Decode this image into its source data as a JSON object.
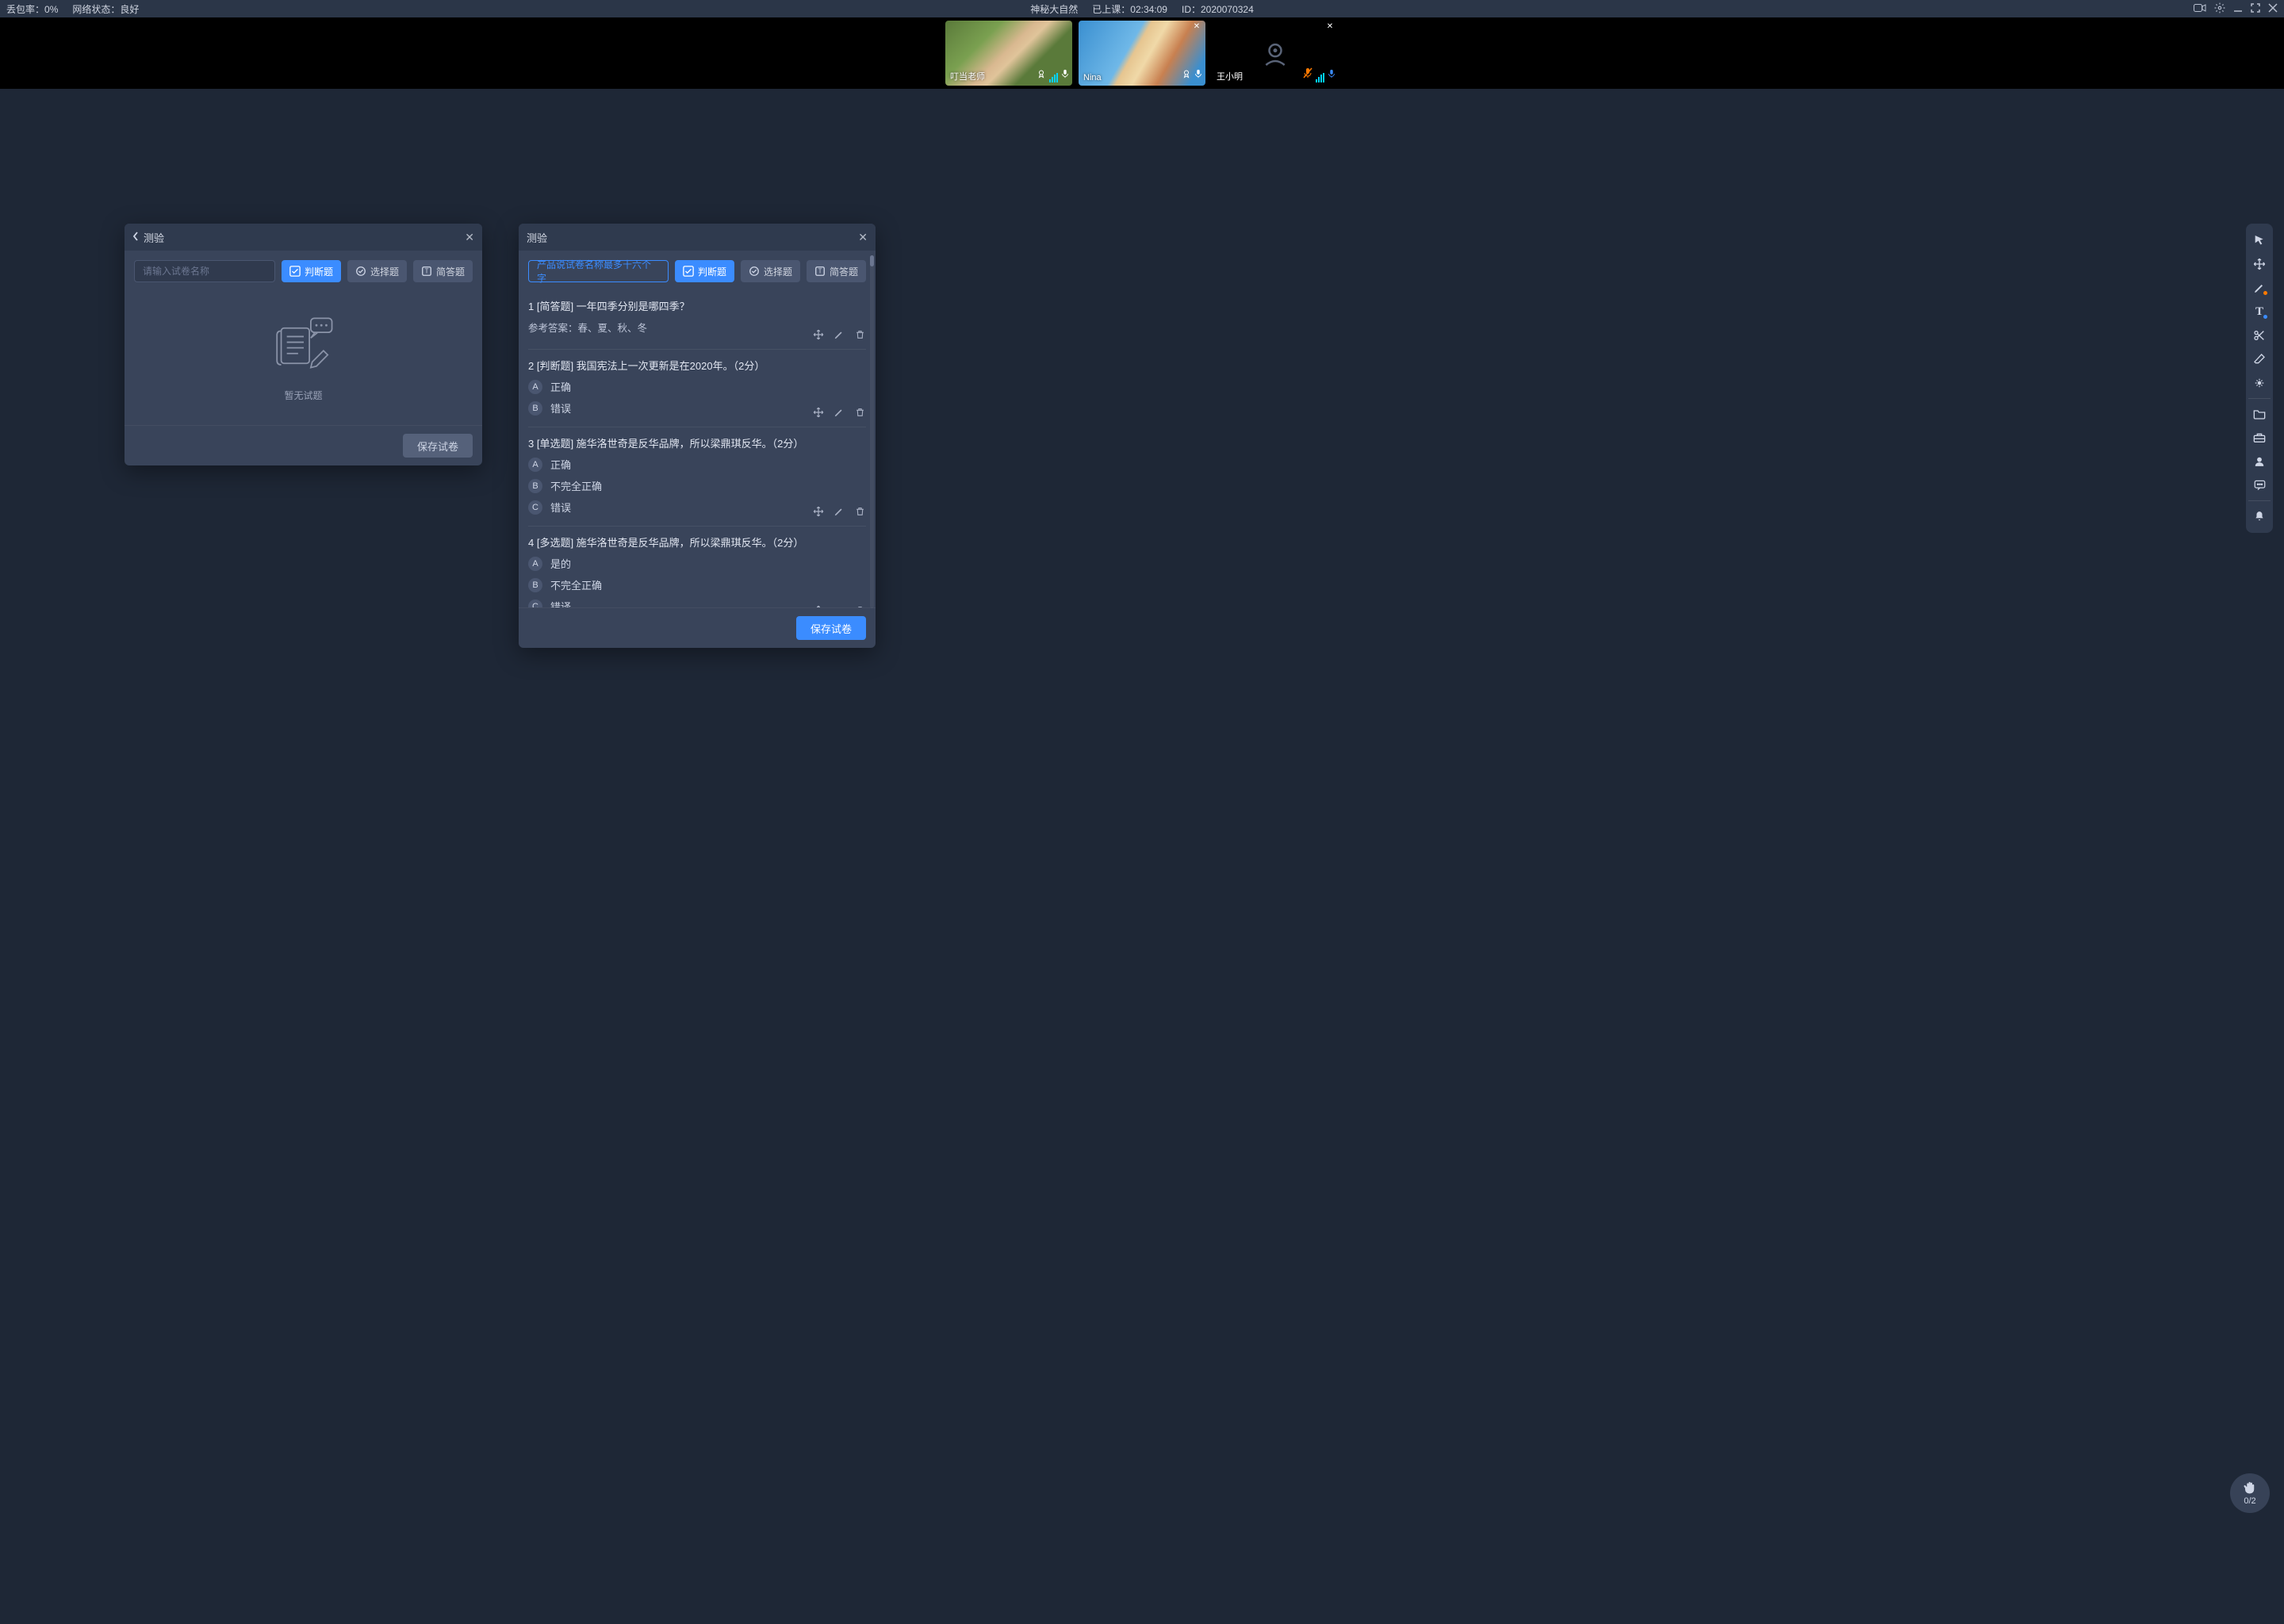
{
  "topbar": {
    "packet_loss_label": "丢包率：",
    "packet_loss_value": "0%",
    "network_label": "网络状态：",
    "network_value": "良好",
    "course_title": "神秘大自然",
    "elapsed_label": "已上课：",
    "elapsed_value": "02:34:09",
    "id_label": "ID：",
    "id_value": "2020070324"
  },
  "participants": [
    {
      "name": "叮当老师",
      "camera": true,
      "closeable": false,
      "mic": "white",
      "award": true
    },
    {
      "name": "Nina",
      "camera": true,
      "closeable": true,
      "mic": "white",
      "award": true
    },
    {
      "name": "王小明",
      "camera": false,
      "closeable": true,
      "mic": "blue",
      "mic_muted": true
    }
  ],
  "left_panel": {
    "title": "测验",
    "name_placeholder": "请输入试卷名称",
    "type_tf": "判断题",
    "type_choice": "选择题",
    "type_short": "简答题",
    "empty_caption": "暂无试题",
    "save_label": "保存试卷"
  },
  "right_panel": {
    "title": "测验",
    "name_value": "产品说试卷名称最多十六个字",
    "type_tf": "判断题",
    "type_choice": "选择题",
    "type_short": "简答题",
    "save_label": "保存试卷",
    "questions": [
      {
        "index": "1",
        "tag": "[简答题]",
        "text": "一年四季分别是哪四季？",
        "answer_label": "参考答案：",
        "answer_text": "春、夏、秋、冬",
        "options": []
      },
      {
        "index": "2",
        "tag": "[判断题]",
        "text": "我国宪法上一次更新是在2020年。（2分）",
        "options": [
          {
            "k": "A",
            "v": "正确"
          },
          {
            "k": "B",
            "v": "错误"
          }
        ]
      },
      {
        "index": "3",
        "tag": "[单选题]",
        "text": "施华洛世奇是反华品牌，所以梁鼎琪反华。（2分）",
        "options": [
          {
            "k": "A",
            "v": "正确"
          },
          {
            "k": "B",
            "v": "不完全正确"
          },
          {
            "k": "C",
            "v": "错误"
          }
        ]
      },
      {
        "index": "4",
        "tag": "[多选题]",
        "text": "施华洛世奇是反华品牌，所以梁鼎琪反华。（2分）",
        "options": [
          {
            "k": "A",
            "v": "是的"
          },
          {
            "k": "B",
            "v": "不完全正确"
          },
          {
            "k": "C",
            "v": "错译"
          }
        ]
      }
    ]
  },
  "hand": {
    "count": "0/2"
  },
  "tool_names": [
    "pointer",
    "move",
    "pen",
    "text",
    "scissors",
    "eraser",
    "laser",
    "folder",
    "toolbox",
    "user",
    "chat",
    "bell"
  ]
}
